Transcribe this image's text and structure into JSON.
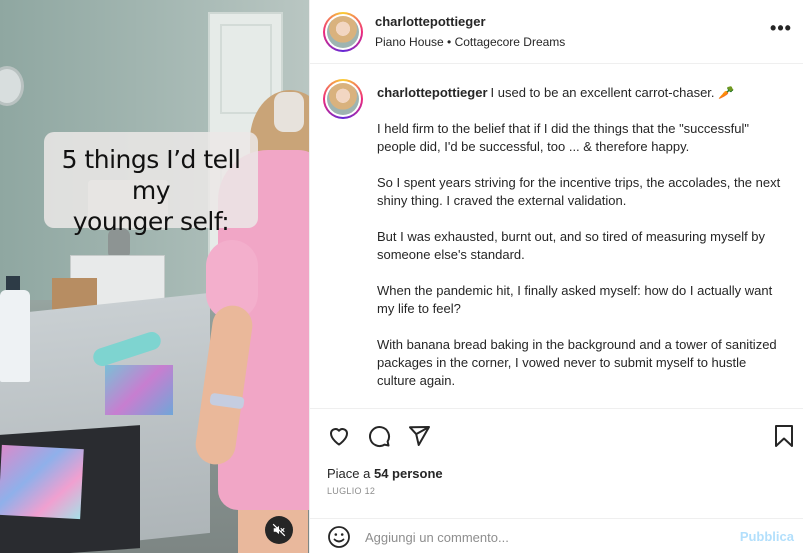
{
  "media": {
    "overlay_line1": "5 things I’d tell my",
    "overlay_line2": "younger self:",
    "mute_icon": "muted-speaker-icon"
  },
  "header": {
    "username": "charlottepottieger",
    "location": "Piano House • Cottagecore Dreams",
    "more_icon": "more-options-icon"
  },
  "caption": {
    "username": "charlottepottieger",
    "paragraphs": [
      "I used to be an excellent carrot-chaser. 🥕",
      "I held firm to the belief that if I did the things that the \"successful\" people did, I'd be successful, too ... & therefore happy.",
      "So I spent years striving for the incentive trips, the accolades, the next shiny thing. I craved the external validation.",
      "But I was exhausted, burnt out, and so tired of measuring myself by someone else's standard.",
      "When the pandemic hit, I finally asked myself: how do I actually want my life to feel?",
      "With banana bread baking in the background and a tower of sanitized packages in the corner, I vowed never to submit myself to hustle culture again."
    ]
  },
  "actions": {
    "icons": [
      "heart-icon",
      "comment-icon",
      "share-icon",
      "bookmark-icon"
    ],
    "likes_prefix": "Piace a ",
    "likes_count": "54 persone",
    "date": "LUGLIO 12"
  },
  "comment": {
    "placeholder": "Aggiungi un commento...",
    "publish_label": "Pubblica",
    "emoji_icon": "emoji-icon"
  },
  "colors": {
    "publish_disabled": "#b2dffc",
    "text": "#262626",
    "muted": "#8e8e8e",
    "dress_pink": "#f1a6c6"
  }
}
